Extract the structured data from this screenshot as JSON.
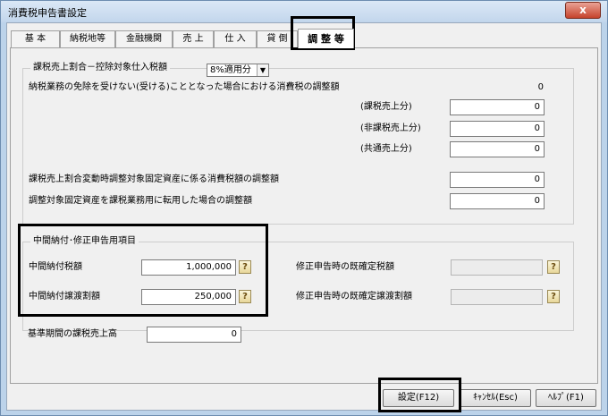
{
  "window": {
    "title": "消費税申告書設定",
    "close_symbol": "x"
  },
  "tabs": [
    "基 本",
    "納税地等",
    "金融機関",
    "売 上",
    "仕 入",
    "貸 倒",
    "調 整 等"
  ],
  "tax_adjustment_group": {
    "legend": "課税売上割合－控除対象仕入税額",
    "rate_select": "8%適用分",
    "exemption_row": {
      "label": "納税業務の免除を受けない(受ける)こととなった場合における消費税の調整額",
      "value": "0"
    },
    "sub_rows": [
      {
        "label": "(課税売上分)",
        "value": "0"
      },
      {
        "label": "(非課税売上分)",
        "value": "0"
      },
      {
        "label": "(共通売上分)",
        "value": "0"
      }
    ],
    "fixed_asset_rows": [
      {
        "label": "課税売上割合変動時調整対象固定資産に係る消費税額の調整額",
        "value": "0"
      },
      {
        "label": "調整対象固定資産を課税業務用に転用した場合の調整額",
        "value": "0"
      }
    ]
  },
  "interim_group": {
    "legend": "中間納付･修正申告用項目",
    "interim_tax": {
      "label": "中間納付税額",
      "value": "1,000,000"
    },
    "interim_transfer": {
      "label": "中間納付譲渡割額",
      "value": "250,000"
    },
    "amended_tax": {
      "label": "修正申告時の既確定税額",
      "value": ""
    },
    "amended_transfer": {
      "label": "修正申告時の既確定譲渡割額",
      "value": ""
    },
    "help_symbol": "?"
  },
  "base_period": {
    "label": "基準期間の課税売上高",
    "value": "0"
  },
  "buttons": {
    "ok": "設定(F12)",
    "cancel": "ｷｬﾝｾﾙ(Esc)",
    "help": "ﾍﾙﾌﾟ(F1)"
  }
}
